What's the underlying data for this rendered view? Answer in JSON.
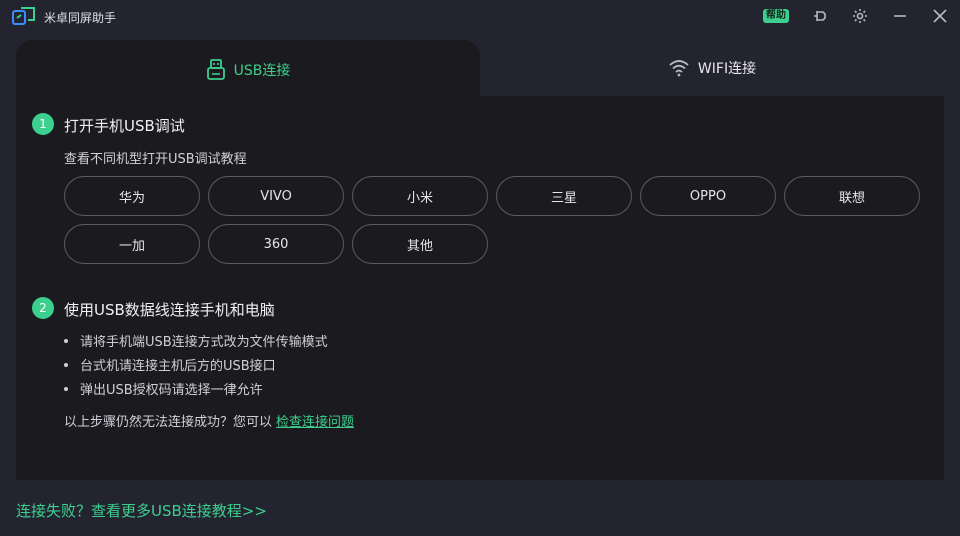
{
  "app": {
    "title": "米卓同屏助手",
    "help_badge": "帮助"
  },
  "tabs": [
    {
      "label": "USB连接",
      "active": true
    },
    {
      "label": "WIFI连接",
      "active": false
    }
  ],
  "step1": {
    "number": "1",
    "title": "打开手机USB调试",
    "subtitle": "查看不同机型打开USB调试教程",
    "brands": [
      "华为",
      "VIVO",
      "小米",
      "三星",
      "OPPO",
      "联想",
      "一加",
      "360",
      "其他"
    ]
  },
  "step2": {
    "number": "2",
    "title": "使用USB数据线连接手机和电脑",
    "bullets": [
      "请将手机端USB连接方式改为文件传输模式",
      "台式机请连接主机后方的USB接口",
      "弹出USB授权码请选择一律允许"
    ],
    "help_prefix": "以上步骤仍然无法连接成功？您可以",
    "help_link": "检查连接问题"
  },
  "footer": {
    "link": "连接失败？查看更多USB连接教程>>"
  },
  "colors": {
    "accent": "#3ccf8e",
    "background": "#242430",
    "panel": "#1b1b1f"
  }
}
